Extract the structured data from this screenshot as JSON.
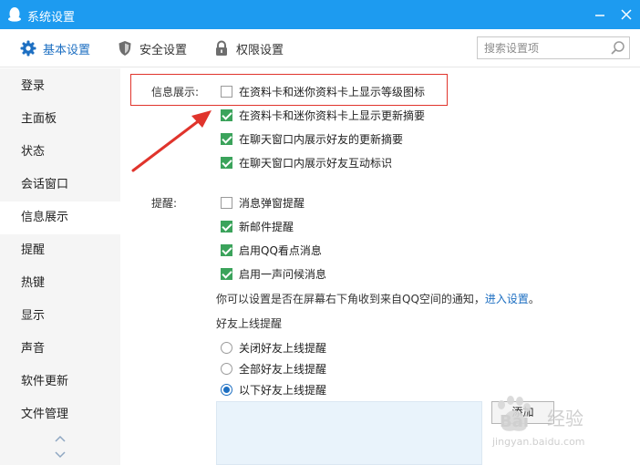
{
  "window": {
    "title": "系统设置",
    "accent": "#1d9bf0"
  },
  "toolbar": {
    "tabs": [
      {
        "label": "基本设置",
        "icon": "gear-icon",
        "selected": true
      },
      {
        "label": "安全设置",
        "icon": "shield-icon",
        "selected": false
      },
      {
        "label": "权限设置",
        "icon": "lock-icon",
        "selected": false
      }
    ],
    "search_placeholder": "搜索设置项"
  },
  "sidebar": {
    "items": [
      {
        "label": "登录"
      },
      {
        "label": "主面板"
      },
      {
        "label": "状态"
      },
      {
        "label": "会话窗口"
      },
      {
        "label": "信息展示",
        "active": true
      },
      {
        "label": "提醒"
      },
      {
        "label": "热键"
      },
      {
        "label": "显示"
      },
      {
        "label": "声音"
      },
      {
        "label": "软件更新"
      },
      {
        "label": "文件管理"
      }
    ]
  },
  "info_display": {
    "label": "信息展示:",
    "options": [
      {
        "label": "在资料卡和迷你资料卡上显示等级图标",
        "checked": false
      },
      {
        "label": "在资料卡和迷你资料卡上显示更新摘要",
        "checked": true
      },
      {
        "label": "在聊天窗口内展示好友的更新摘要",
        "checked": true
      },
      {
        "label": "在聊天窗口内展示好友互动标识",
        "checked": true
      }
    ]
  },
  "reminder": {
    "label": "提醒:",
    "options": [
      {
        "label": "消息弹窗提醒",
        "checked": false
      },
      {
        "label": "新邮件提醒",
        "checked": true
      },
      {
        "label": "启用QQ看点消息",
        "checked": true
      },
      {
        "label": "启用一声问候消息",
        "checked": true
      }
    ],
    "note_text": "你可以设置是否在屏幕右下角收到来自QQ空间的通知，",
    "note_link": "进入设置",
    "note_end": "。"
  },
  "friends_online": {
    "title": "好友上线提醒",
    "options": [
      {
        "label": "关闭好友上线提醒",
        "selected": false
      },
      {
        "label": "全部好友上线提醒",
        "selected": false
      },
      {
        "label": "以下好友上线提醒",
        "selected": true
      }
    ],
    "add_label": "添加"
  },
  "watermark": {
    "brand": "Baidu",
    "text": "经验",
    "url": "jingyan.baidu.com"
  }
}
